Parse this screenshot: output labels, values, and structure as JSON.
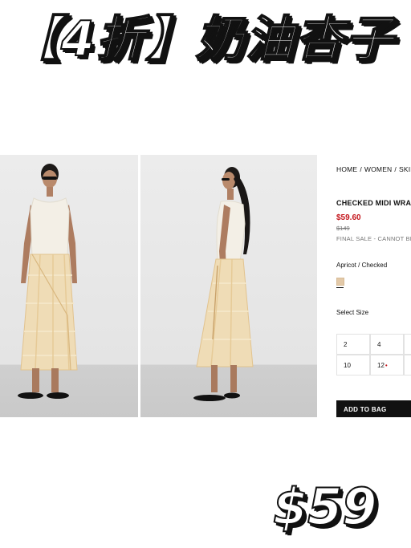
{
  "overlay": {
    "headline": "【4折】奶油杏子",
    "price_sticker": "$59"
  },
  "product_page": {
    "breadcrumb": [
      "HOME",
      "WOMEN",
      "SKIRT"
    ],
    "breadcrumb_separator": "/",
    "product_title": "CHECKED MIDI WRA",
    "sale_price": "$59.60",
    "original_price": "$149",
    "final_sale_note": "FINAL SALE - CANNOT BE",
    "color_label": "Apricot / Checked",
    "swatch_color": "#e3c9a8",
    "select_size_label": "Select Size",
    "sizes": [
      {
        "label": "2",
        "low_stock": false
      },
      {
        "label": "4",
        "low_stock": false
      },
      {
        "label": "10",
        "low_stock": false
      },
      {
        "label": "12",
        "low_stock": true
      }
    ],
    "add_to_bag_label": "ADD TO BAG",
    "sale_color": "#c4161c"
  },
  "images": [
    {
      "name": "model-front-view",
      "icon": "product-photo"
    },
    {
      "name": "model-side-view",
      "icon": "product-photo"
    }
  ]
}
